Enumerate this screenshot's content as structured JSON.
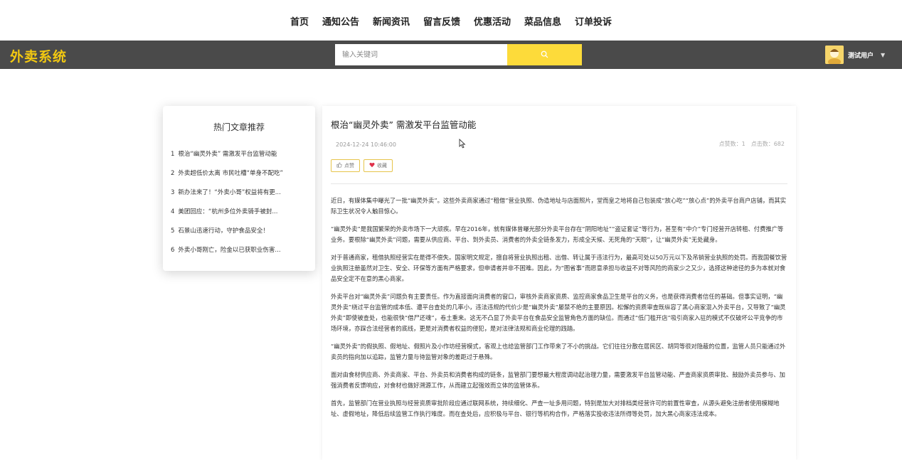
{
  "nav": [
    "首页",
    "通知公告",
    "新闻资讯",
    "留言反馈",
    "优惠活动",
    "菜品信息",
    "订单投诉"
  ],
  "brand": "外卖系统",
  "search": {
    "placeholder": "输入关键词"
  },
  "user": {
    "name": "测试用户"
  },
  "hot": {
    "title": "热门文章推荐",
    "items": [
      "根治“幽灵外卖” 需激发平台监管动能",
      "外卖超低价太离 市民吐槽“单身不配吃”",
      "新办法来了！“外卖小哥”权益将有更...",
      "美团回应：“杭州多位外卖骑手被封...",
      "石景山迅速行动，守护食品安全！",
      "外卖小哥刚亡，险金以已获职业伤害..."
    ]
  },
  "article": {
    "title": "根治“幽灵外卖” 需激发平台监管动能",
    "datetime": "2024-12-24 10:46:00",
    "likes": "点赞数：1",
    "views": "点击数：682",
    "like_label": "点赞",
    "fav_label": "收藏",
    "paragraphs": [
      "近日，有媒体集中曝光了一批“幽灵外卖”。这些外卖商家通过“租借”营业执照、伪造地址与店面照片，堂而皇之地将自己包装成“放心吃”“放心点”的外卖平台商户店铺，而其实际卫生状况令人触目惊心。",
      "“幽灵外卖”是我国繁荣的外卖市场下一大顽疾。早在2016年，就有媒体曾曝光部分外卖平台存在“阴阳地址”“盗证套证”等行为，甚至有“中介”专门经营开店转租、付费推广等业务。要根除“幽灵外卖”问题，需要从供应商、平台、到外卖员、消费者的外卖全链条发力，形成全天候、无死角的“天眼”，让“幽灵外卖”无处藏身。",
      "对于普通商家，租借执照经营实在是得不偿失。国家明文规定，擅自将营业执照出租、出借、转让属于违法行为，最高可处以50万元以下及吊销营业执照的处罚。而我国餐饮营业执照注册虽然对卫生、安全、环保等方面有严格要求，但申请者并非不困难。因此，为“图省事”而愿意承担与收益不对等风险的商家少之又少，选择这种途径的多为本就对食品安全定不在意的黑心商家。",
      "外卖平台对“幽灵外卖”问题负有主要责任。作为直接面向消费者的窗口，审核外卖商家资质、监控商家食品卫生是平台的义务，也是获得消费者信任的基础。但事实证明，“幽灵外卖”绕过平台监管的成本低、遭平台查处的几率小，违法违规的代价少是“幽灵外卖”屡禁不绝的主要原因。松懈的资质审查既纵容了黑心商家混入外卖平台，又导致了“幽灵外卖”即使被查处，也能很快“借尸还魂”，卷土重来。这无不凸显了外卖平台在食品安全监管角色方面的缺位。而通过“低门槛开店”吸引商家入驻的模式不仅破坏公平竞争的市场环境，亦踩合法经营者的底线，更是对消费者权益的侵犯，是对法律法规和商业伦理的践踏。",
      "“幽灵外卖”的假执照、假地址、假照片及小作坊经营模式，客观上也给监管部门工作带来了不小的挑战。它们往往分散在居民区、胡同等很对隐蔽的位置，监管人员只能通过外卖员的指向加以追踪，监管力量与待监管对象的差距过于悬殊。",
      "面对由食材供应商、外卖商家、平台、外卖员和消费者构成的链条，监管部门要想最大程度调动起治理力量，需要激发平台监管动能、严查商家资质审批、鼓励外卖员参与、加强消费者反馈响应，对食材也做好溯源工作，从而建立起强效而立体的监管体系。",
      "首先，监管部门在营业执照与经营资质审批阶段应通过联网系统，持续细化、严查一址多用问题，特别是加大对排档类经营许可的前置性审查，从源头避免注册者使用模糊地址、虚假地址，降低后续监管工作执行难度。而在查处后，应积极与平台、银行等机构合作，严格落实投收违法所得等处罚，加大黑心商家违法成本。"
    ]
  }
}
